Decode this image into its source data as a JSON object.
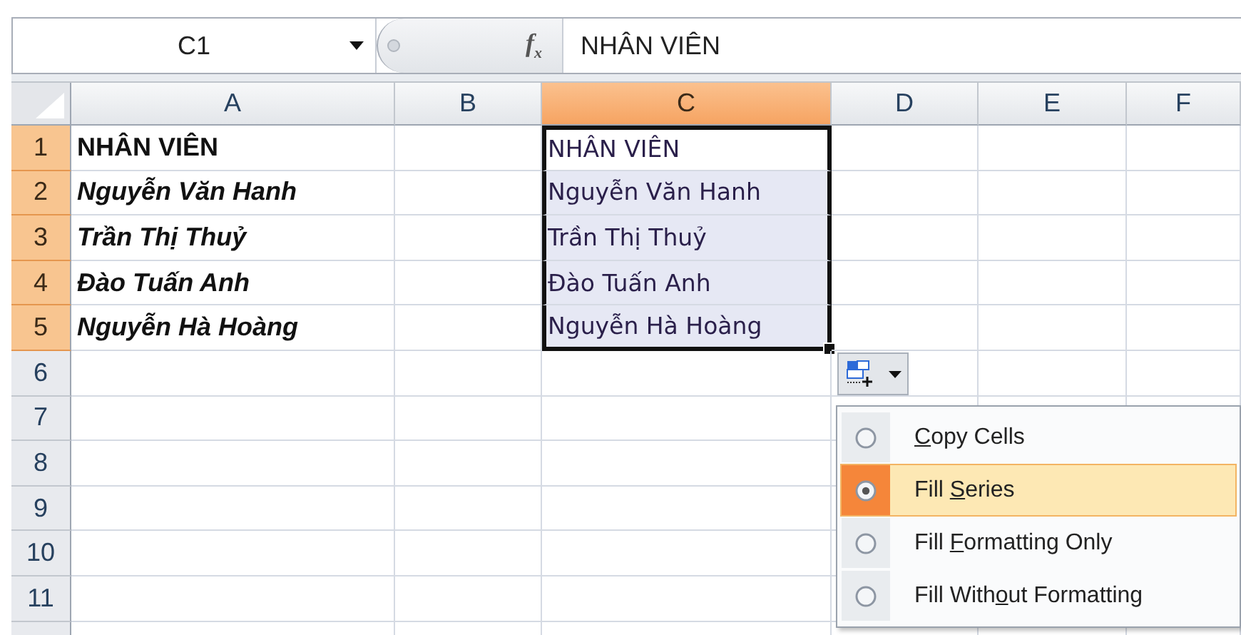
{
  "name_box": {
    "value": "C1"
  },
  "formula_bar": {
    "function_button": "f$_{x}$",
    "value": "NHÂN VIÊN"
  },
  "columns": [
    {
      "label": "A",
      "selected": false
    },
    {
      "label": "B",
      "selected": false
    },
    {
      "label": "C",
      "selected": true
    },
    {
      "label": "D",
      "selected": false
    },
    {
      "label": "E",
      "selected": false
    },
    {
      "label": "F",
      "selected": false
    }
  ],
  "rows": [
    {
      "label": "1",
      "selected": true,
      "column_a": {
        "text": "NHÂN VIÊN",
        "bold": true,
        "italic": false
      },
      "column_c": {
        "text": "NHÂN VIÊN",
        "selected": true,
        "active": true
      }
    },
    {
      "label": "2",
      "selected": true,
      "column_a": {
        "text": "Nguyễn Văn Hanh",
        "bold": true,
        "italic": true
      },
      "column_c": {
        "text": "Nguyễn Văn Hanh",
        "selected": true,
        "active": false
      }
    },
    {
      "label": "3",
      "selected": true,
      "column_a": {
        "text": "Trần Thị Thuỷ",
        "bold": true,
        "italic": true
      },
      "column_c": {
        "text": "Trần Thị Thuỷ",
        "selected": true,
        "active": false
      }
    },
    {
      "label": "4",
      "selected": true,
      "column_a": {
        "text": "Đào Tuấn Anh",
        "bold": true,
        "italic": true
      },
      "column_c": {
        "text": "Đào Tuấn Anh",
        "selected": true,
        "active": false
      }
    },
    {
      "label": "5",
      "selected": true,
      "column_a": {
        "text": "Nguyễn Hà Hoàng",
        "bold": true,
        "italic": true
      },
      "column_c": {
        "text": "Nguyễn Hà Hoàng",
        "selected": true,
        "active": false
      }
    },
    {
      "label": "6",
      "selected": false
    },
    {
      "label": "7",
      "selected": false
    },
    {
      "label": "8",
      "selected": false
    },
    {
      "label": "9",
      "selected": false
    },
    {
      "label": "10",
      "selected": false
    },
    {
      "label": "11",
      "selected": false
    },
    {
      "selected": false
    }
  ],
  "autofill_menu": {
    "items": [
      {
        "label": {
          "key": "C",
          "after": "opy Cells"
        },
        "selected": false
      },
      {
        "label": {
          "before": "Fill ",
          "key": "S",
          "after": "eries"
        },
        "selected": true
      },
      {
        "label": {
          "before": "Fill ",
          "key": "F",
          "after": "ormatting Only"
        },
        "selected": false
      },
      {
        "label": {
          "before": "Fill With",
          "key": "o",
          "after": "ut Formatting"
        },
        "selected": false
      }
    ]
  }
}
